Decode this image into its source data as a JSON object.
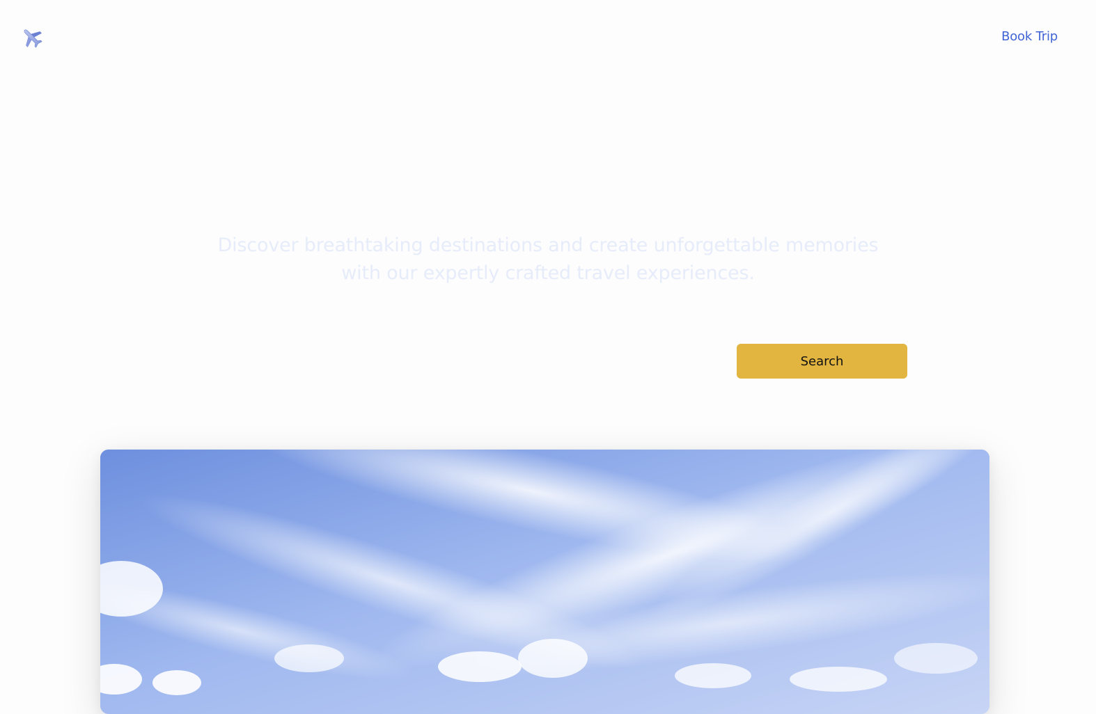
{
  "header": {
    "logo_icon": "airplane-icon",
    "nav_link": "Book Trip"
  },
  "hero": {
    "subtitle_line1": "Discover breathtaking destinations and create unforgettable memories",
    "subtitle_line2": "with our expertly crafted travel experiences."
  },
  "search": {
    "input_value": "",
    "input_placeholder": "",
    "button_label": "Search"
  },
  "colors": {
    "accent": "#e2b541",
    "link": "#4064d6",
    "subtitle": "#e7ecfa",
    "background": "#fdfdfd"
  }
}
